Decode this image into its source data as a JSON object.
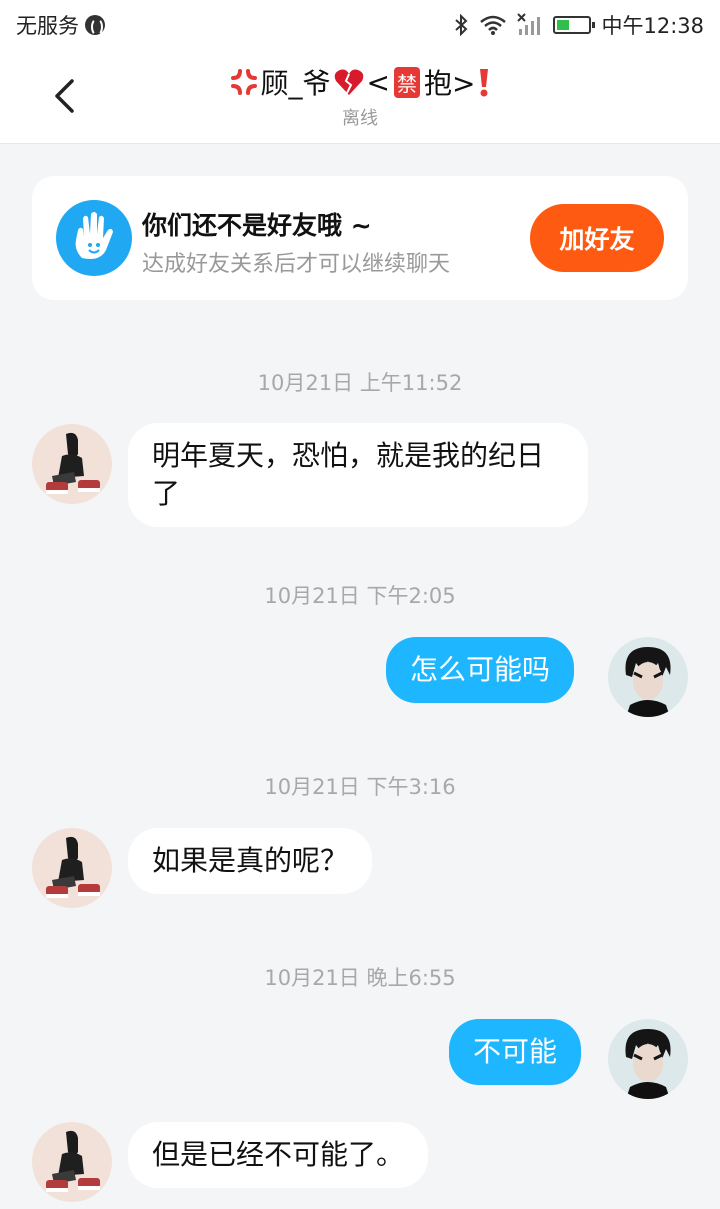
{
  "status_bar": {
    "carrier": "无服务",
    "time": "中午12:38",
    "icons": [
      "globe-icon",
      "bluetooth-icon",
      "wifi-icon",
      "signal-icon",
      "battery-icon"
    ]
  },
  "header": {
    "title_name": "顾_爷",
    "title_ban_char": "禁",
    "title_after_ban": "抱>",
    "title_lt": "<",
    "status": "离线"
  },
  "friend_card": {
    "title": "你们还不是好友哦 ~",
    "subtitle": "达成好友关系后才可以继续聊天",
    "button_label": "加好友"
  },
  "messages": [
    {
      "timestamp": "10月21日 上午11:52",
      "side": "incoming",
      "text": "明年夏天，恐怕，就是我的纪日了"
    },
    {
      "timestamp": "10月21日 下午2:05",
      "side": "outgoing",
      "text": "怎么可能吗"
    },
    {
      "timestamp": "10月21日 下午3:16",
      "side": "incoming",
      "text": "如果是真的呢？"
    },
    {
      "timestamp": "10月21日 晚上6:55",
      "side": "outgoing",
      "text": "不可能"
    },
    {
      "timestamp": "",
      "side": "incoming",
      "text": "但是已经不可能了。"
    }
  ],
  "colors": {
    "accent_blue": "#1eb6ff",
    "add_button": "#ff5a12",
    "background": "#f4f5f7"
  }
}
